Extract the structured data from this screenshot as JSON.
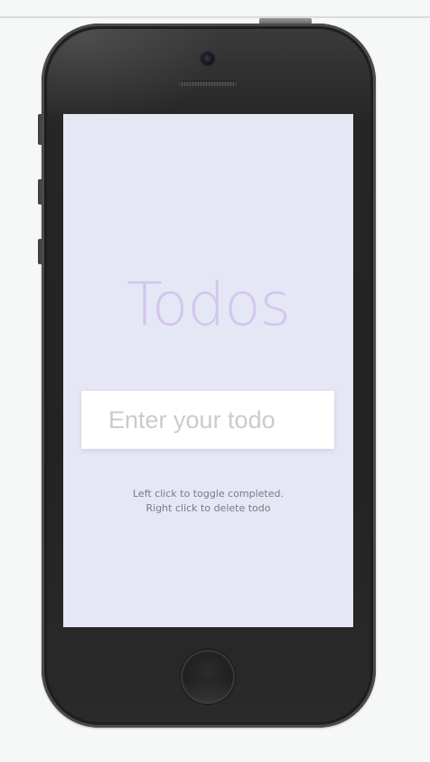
{
  "app": {
    "title": "Todos"
  },
  "todo_input": {
    "placeholder": "Enter your todo",
    "value": ""
  },
  "help": {
    "line1": "Left click to toggle completed.",
    "line2": "Right click to delete todo"
  },
  "colors": {
    "screen_background": "#e6e7f5",
    "title": "#d3c6ef",
    "input_background": "#ffffff",
    "help_text": "#7a7a82",
    "device_body": "#232323"
  },
  "device": {
    "camera_icon": "camera-icon",
    "home_button_icon": "home-button-icon"
  }
}
